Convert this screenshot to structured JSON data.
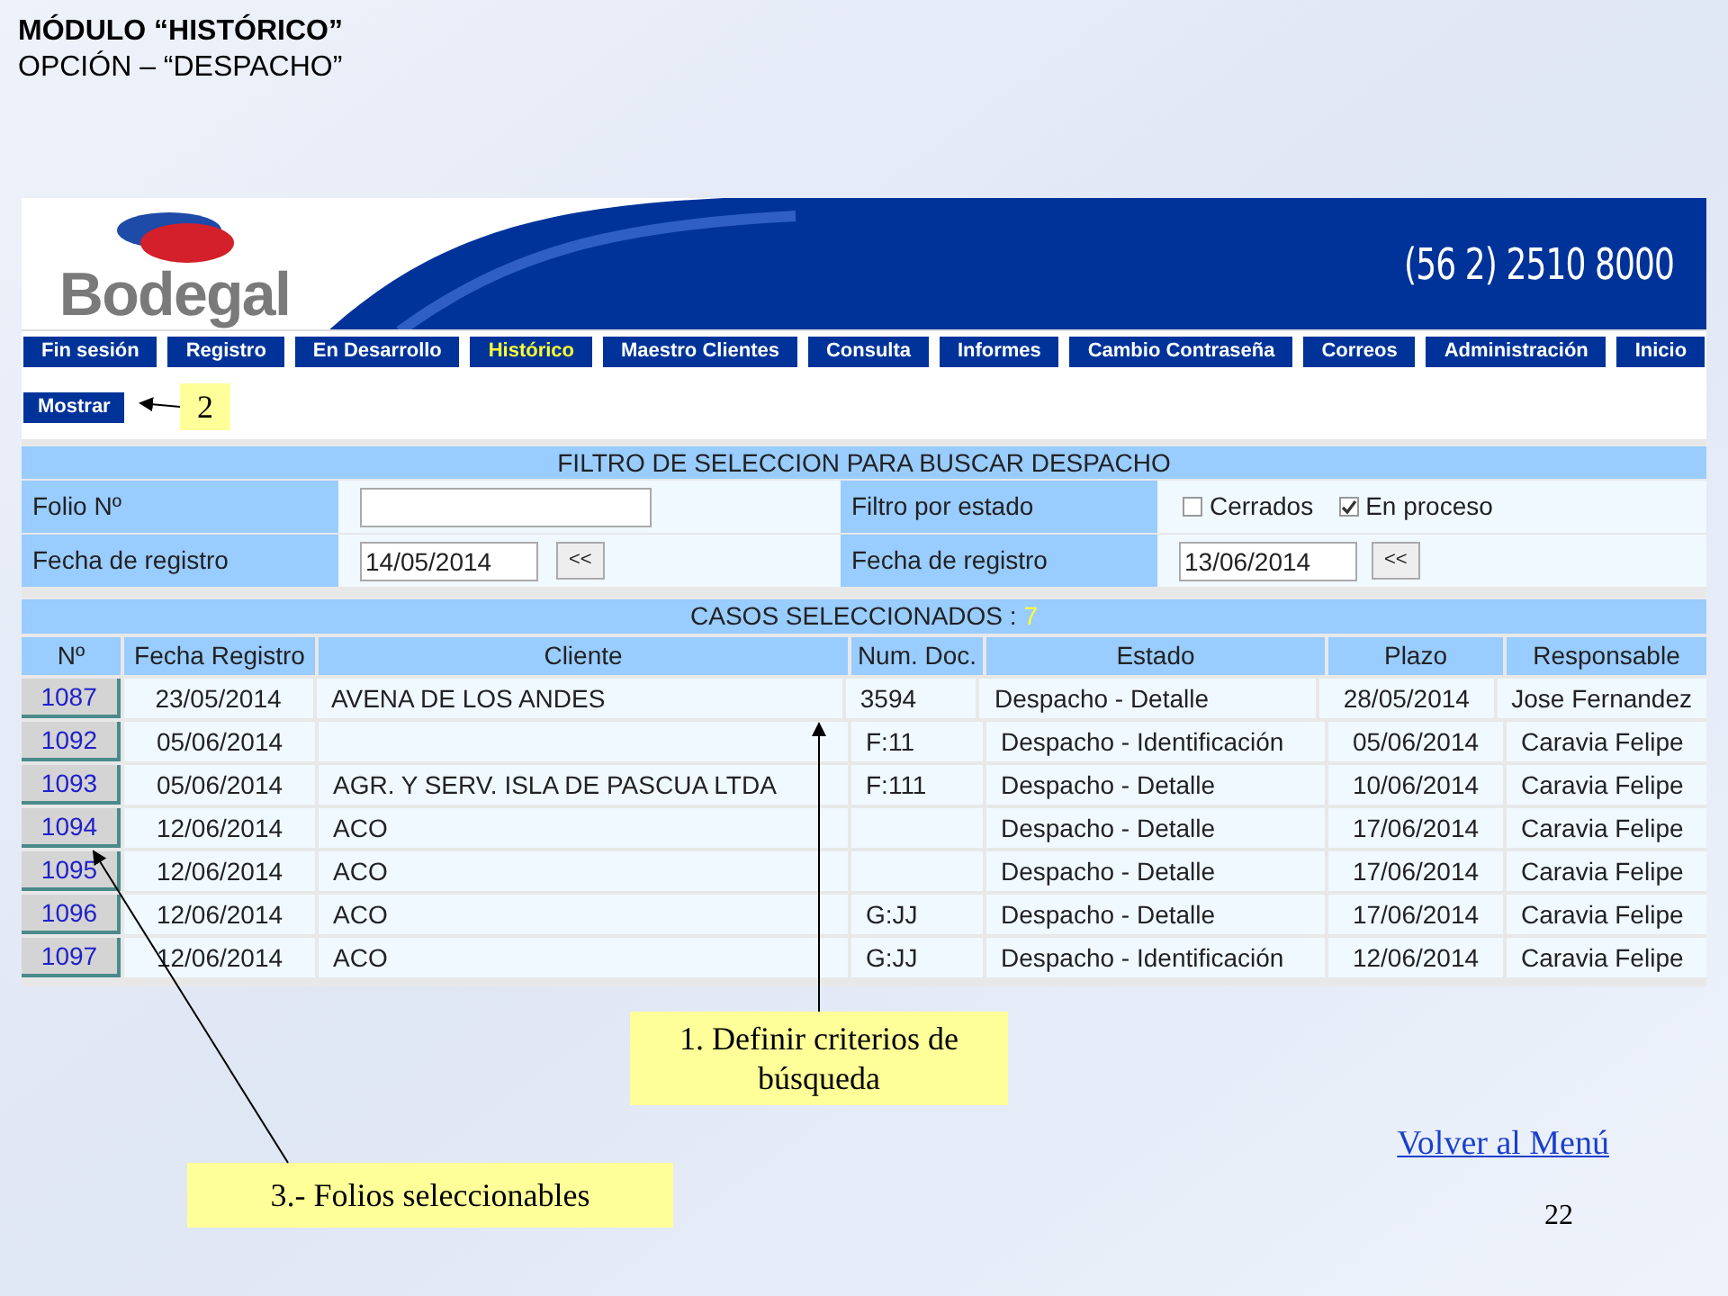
{
  "slide": {
    "title": "MÓDULO “HISTÓRICO”",
    "subtitle": "OPCIÓN – “DESPACHO”",
    "page_number": "22",
    "link": "Volver al Menú"
  },
  "app": {
    "logo": "Bodegal",
    "phone": "(56 2) 2510 8000",
    "nav": [
      {
        "label": "Fin sesión",
        "selected": false
      },
      {
        "label": "Registro",
        "selected": false
      },
      {
        "label": "En Desarrollo",
        "selected": false
      },
      {
        "label": "Histórico",
        "selected": true
      },
      {
        "label": "Maestro Clientes",
        "selected": false
      },
      {
        "label": "Consulta",
        "selected": false
      },
      {
        "label": "Informes",
        "selected": false
      },
      {
        "label": "Cambio Contraseña",
        "selected": false
      },
      {
        "label": "Correos",
        "selected": false
      },
      {
        "label": "Administración",
        "selected": false
      },
      {
        "label": "Inicio",
        "selected": false
      }
    ],
    "toolbar_button": "Mostrar",
    "filter": {
      "title": "FILTRO DE SELECCION PARA BUSCAR DESPACHO",
      "folio_label": "Folio Nº",
      "status_label": "Filtro por estado",
      "statuses": [
        {
          "label": "Cerrados",
          "checked": false
        },
        {
          "label": "En proceso",
          "checked": true
        }
      ],
      "date_from_label": "Fecha de registro",
      "date_from": "14/05/2014",
      "date_from_button": "<<",
      "date_to_label": "Fecha de registro",
      "date_to": "13/06/2014",
      "date_to_button": "<<"
    },
    "cases": {
      "title": "CASOS SELECCIONADOS : ",
      "count": "7",
      "columns": [
        "Nº",
        "Fecha Registro",
        "Cliente",
        "Num. Doc.",
        "Estado",
        "Plazo",
        "Responsable"
      ],
      "rows": [
        {
          "folio": "1087",
          "fecha": "23/05/2014",
          "cliente": "AVENA DE LOS ANDES",
          "num_doc": "3594",
          "estado": "Despacho - Detalle",
          "plazo": "28/05/2014",
          "responsable": "Jose Fernandez"
        },
        {
          "folio": "1092",
          "fecha": "05/06/2014",
          "num_doc": "F:11",
          "estado": "Despacho - Identificación",
          "plazo": "05/06/2014",
          "responsable": "Caravia Felipe"
        },
        {
          "folio": "1093",
          "fecha": "05/06/2014",
          "cliente": "AGR. Y SERV. ISLA DE PASCUA LTDA",
          "num_doc": "F:111",
          "estado": "Despacho - Detalle",
          "plazo": "10/06/2014",
          "responsable": "Caravia Felipe"
        },
        {
          "folio": "1094",
          "fecha": "12/06/2014",
          "cliente": "ACO",
          "estado": "Despacho - Detalle",
          "plazo": "17/06/2014",
          "responsable": "Caravia Felipe"
        },
        {
          "folio": "1095",
          "fecha": "12/06/2014",
          "cliente": "ACO",
          "estado": "Despacho - Detalle",
          "plazo": "17/06/2014",
          "responsable": "Caravia Felipe"
        },
        {
          "folio": "1096",
          "fecha": "12/06/2014",
          "cliente": "ACO",
          "num_doc": "G:JJ",
          "estado": "Despacho - Detalle",
          "plazo": "17/06/2014",
          "responsable": "Caravia Felipe"
        },
        {
          "folio": "1097",
          "fecha": "12/06/2014",
          "cliente": "ACO",
          "num_doc": "G:JJ",
          "estado": "Despacho - Identificación",
          "plazo": "12/06/2014",
          "responsable": "Caravia Felipe"
        }
      ]
    }
  },
  "callouts": [
    "2",
    "1. Definir criterios de búsqueda",
    "3.- Folios seleccionables"
  ]
}
